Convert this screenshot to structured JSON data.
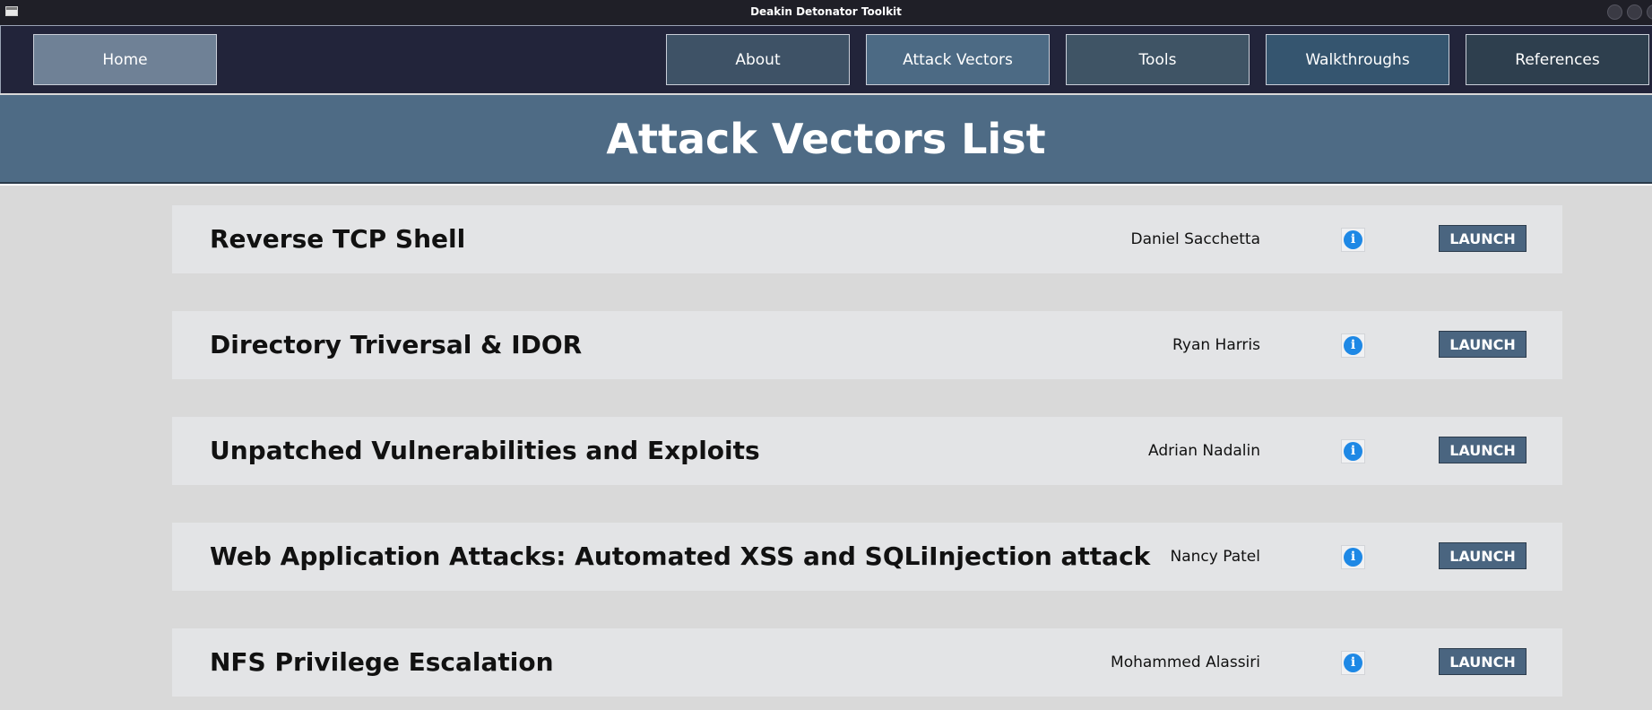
{
  "window": {
    "title": "Deakin Detonator Toolkit"
  },
  "nav": {
    "items": [
      {
        "label": "Home",
        "color": "#6f8196"
      },
      {
        "label": "About",
        "color": "#3e5266"
      },
      {
        "label": "Attack Vectors",
        "color": "#4c6a84"
      },
      {
        "label": "Tools",
        "color": "#3f5465"
      },
      {
        "label": "Walkthroughs",
        "color": "#35556f"
      },
      {
        "label": "References",
        "color": "#2e3f4e"
      }
    ]
  },
  "header": {
    "title": "Attack Vectors List",
    "color": "#4e6b85"
  },
  "attack_vectors": [
    {
      "title": "Reverse TCP Shell",
      "author": "Daniel Sacchetta",
      "info_glyph": "i",
      "launch_label": "LAUNCH"
    },
    {
      "title": "Directory Triversal & IDOR",
      "author": "Ryan Harris",
      "info_glyph": "i",
      "launch_label": "LAUNCH"
    },
    {
      "title": "Unpatched Vulnerabilities and Exploits",
      "author": "Adrian Nadalin",
      "info_glyph": "i",
      "launch_label": "LAUNCH"
    },
    {
      "title": "Web Application Attacks: Automated XSS and SQLiInjection attack",
      "author": "Nancy Patel",
      "info_glyph": "i",
      "launch_label": "LAUNCH"
    },
    {
      "title": "NFS Privilege Escalation",
      "author": "Mohammed Alassiri",
      "info_glyph": "i",
      "launch_label": "LAUNCH"
    }
  ]
}
